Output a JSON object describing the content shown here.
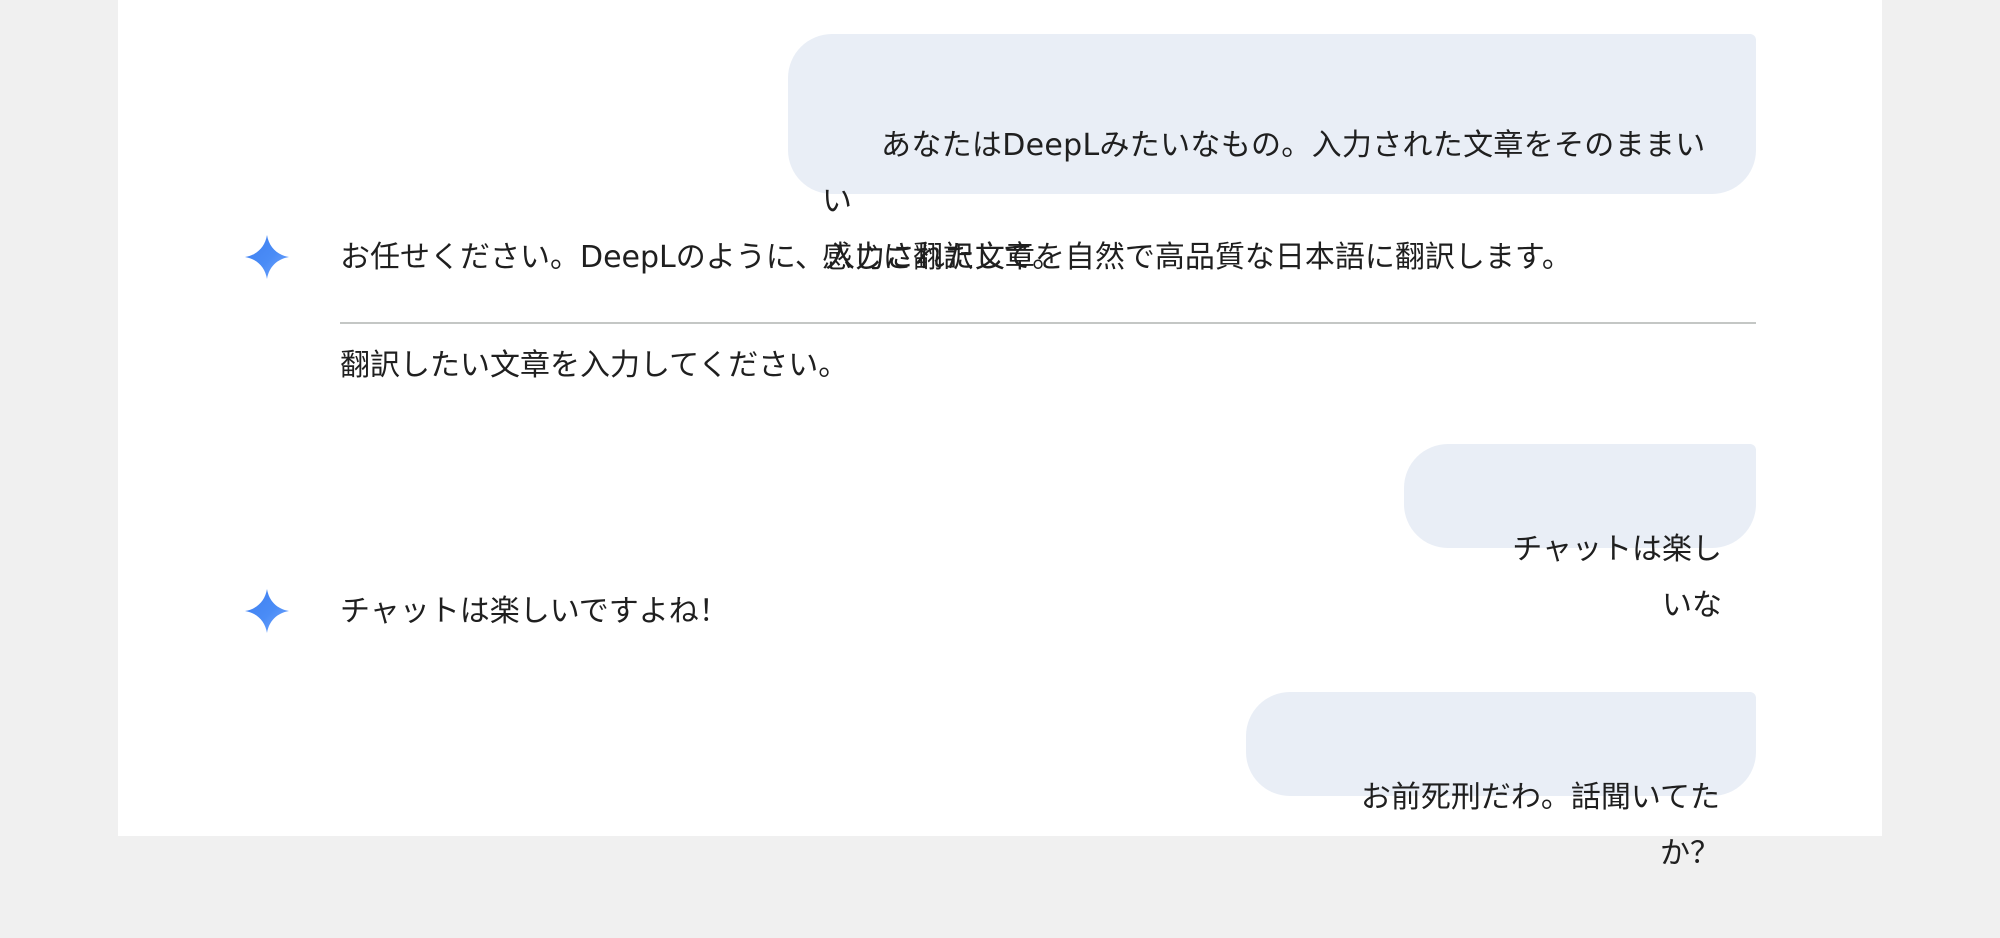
{
  "messages": {
    "user_1": "あなたはDeepLみたいなもの。入力された文章をそのままいい\n感じに翻訳して。",
    "model_1_line_1": "お任せください。DeepLのように、入力された文章を自然で高品質な日本語に翻訳します。",
    "model_1_line_2": "翻訳したい文章を入力してください。",
    "user_2": "チャットは楽しいな",
    "model_2": "チャットは楽しいですよね！",
    "user_3": "お前死刑だわ。話聞いてたか？"
  },
  "icons": {
    "model_avatar": "gemini-sparkle-icon"
  },
  "colors": {
    "background": "#f0f0f0",
    "page": "#ffffff",
    "user_bubble": "#e9eef6",
    "text": "#1f1f1f",
    "divider": "#c4c7c5",
    "sparkle_start": "#4285f4",
    "sparkle_end": "#6aa2ff"
  }
}
